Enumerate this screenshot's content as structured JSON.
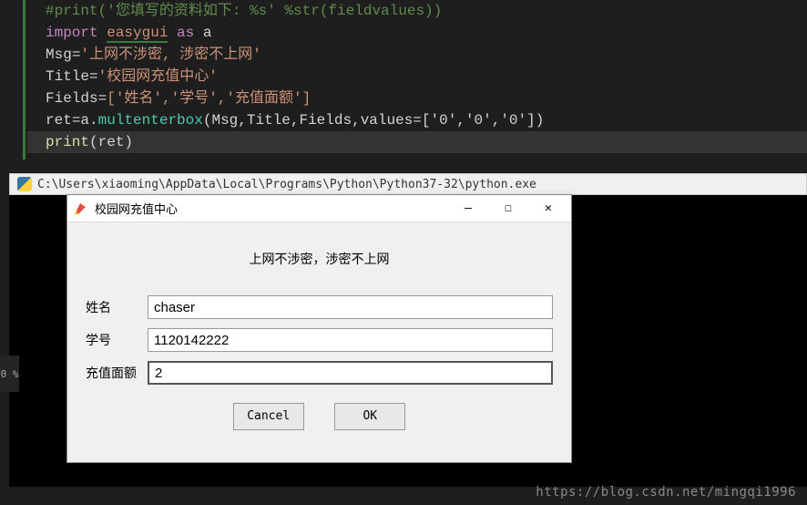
{
  "code": {
    "line0": "#print('您填写的资料如下: %s' %str(fieldvalues))",
    "line1_import": "import",
    "line1_mod": "easygui",
    "line1_as": "as",
    "line1_alias": "a",
    "line2_var": "Msg",
    "line2_str": "'上网不涉密, 涉密不上网'",
    "line3_var": "Title",
    "line3_str": "'校园网充值中心'",
    "line4_var": "Fields",
    "line4_val": "['姓名','学号','充值面额']",
    "line5_var": "ret",
    "line5_obj": "a",
    "line5_func": "multenterbox",
    "line5_args": "(Msg,Title,Fields,values=['0','0','0'])",
    "line6_func": "print",
    "line6_args": "(ret)"
  },
  "terminal": {
    "path": "C:\\Users\\xiaoming\\AppData\\Local\\Programs\\Python\\Python37-32\\python.exe"
  },
  "dialog": {
    "title": "校园网充值中心",
    "message": "上网不涉密，涉密不上网",
    "fields": [
      {
        "label": "姓名",
        "value": "chaser"
      },
      {
        "label": "学号",
        "value": "1120142222"
      },
      {
        "label": "充值面额",
        "value": "2"
      }
    ],
    "buttons": {
      "cancel": "Cancel",
      "ok": "OK"
    }
  },
  "sidebar": {
    "percent": "0 %"
  },
  "watermark": "https://blog.csdn.net/mingqi1996"
}
